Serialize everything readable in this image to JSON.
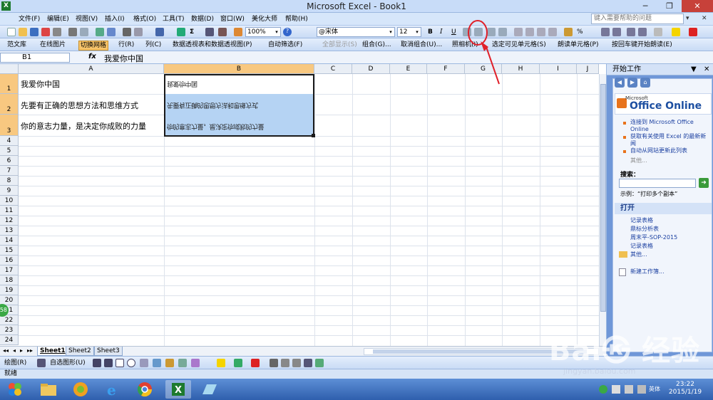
{
  "window": {
    "title": "Microsoft Excel - Book1",
    "icon_label": "X",
    "minimize": "─",
    "maximize": "❐",
    "close": "✕"
  },
  "menu": {
    "items": [
      "文件(F)",
      "编辑(E)",
      "视图(V)",
      "插入(I)",
      "格式(O)",
      "工具(T)",
      "数据(D)",
      "窗口(W)",
      "美化大师",
      "帮助(H)"
    ],
    "help_placeholder": "键入需要帮助的问题",
    "help_arrow": "▾",
    "close_btn": "✕"
  },
  "toolbar1": {
    "zoom": "100%",
    "font": "@宋体",
    "font_size": "12",
    "bold": "B",
    "italic": "I",
    "underline": "U",
    "sigma": "Σ",
    "percent": "%",
    "help_q": "?",
    "arrow_down": "▾"
  },
  "toolbar2": {
    "items": [
      "范文库",
      "在线图片",
      "切换网格",
      "行(R)",
      "列(C)",
      "数据透视表和数据透视图(P)",
      "自动筛选(F)",
      "全部显示(S)",
      "组合(G)...",
      "取消组合(U)...",
      "照相机(I)",
      "选定可见单元格(S)",
      "朗读单元格(P)",
      "按回车键开始朗读(E)"
    ]
  },
  "formula_bar": {
    "cell_ref": "B1",
    "fx": "fx",
    "content": "我爱你中国"
  },
  "grid": {
    "columns": [
      "A",
      "B",
      "C",
      "D",
      "E",
      "F",
      "G",
      "H",
      "I",
      "J"
    ],
    "rows": [
      "1",
      "2",
      "3",
      "4",
      "5",
      "6",
      "7",
      "8",
      "9",
      "10",
      "11",
      "12",
      "13",
      "14",
      "15",
      "16",
      "17",
      "18",
      "19",
      "20",
      "21",
      "22",
      "23",
      "24"
    ],
    "cells": {
      "A1": "我爱你中国",
      "A2": "先要有正确的思想方法和思维方式",
      "A3": "你的意志力量，是决定你成败的力量",
      "B1": "我爱你中国",
      "B2": "先要有正确的思想方法和思维方式",
      "B3": "你的意志力量，是决定你成败的力量"
    },
    "selected_range": "B1:B3",
    "side_badge": "58"
  },
  "sheets": {
    "tabs": [
      "Sheet1",
      "Sheet2",
      "Sheet3"
    ],
    "active": "Sheet1",
    "nav": [
      "◂◂",
      "◂",
      "▸",
      "▸▸"
    ]
  },
  "taskpane": {
    "title": "开始工作",
    "close": "✕",
    "menu_arrow": "▼",
    "brand_small": "Microsoft",
    "brand": "Office Online",
    "links": [
      "连接到 Microsoft Office Online",
      "获取有关使用 Excel 的最新新闻",
      "自动从网站更新此列表",
      "其他..."
    ],
    "search_label": "搜索：",
    "search_go": "➜",
    "example": "示例：“打印多个副本”",
    "open_header": "打开",
    "recent": [
      "记录表格",
      "鼎标分析表",
      "周末平-SOP-2015",
      "记录表格",
      "其他..."
    ],
    "new_workbook": "新建工作簿..."
  },
  "drawbar": {
    "draw_label": "绘图(R)",
    "autoshape_label": "自选图形(U)"
  },
  "status": {
    "text": "就绪"
  },
  "taskbar": {
    "time": "23:22",
    "date": "2015/1/19",
    "ime": "英体"
  },
  "watermark": {
    "brand": "Bai㉿ 经验",
    "url": "jingyan.baidu.com"
  },
  "colors": {
    "accent": "#c7413a",
    "selection": "#b5d3f3",
    "header_selected": "#f8c880",
    "annotation": "#e0202a"
  }
}
